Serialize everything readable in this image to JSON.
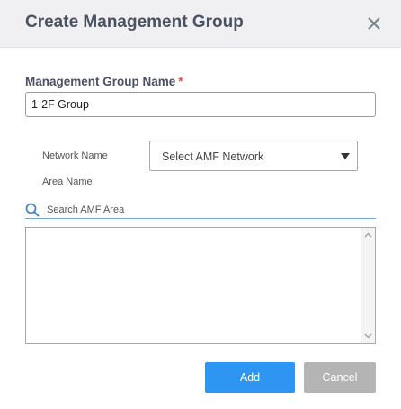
{
  "dialog": {
    "title": "Create Management Group"
  },
  "form": {
    "group_name_label": "Management Group Name",
    "required_marker": "*",
    "group_name_value": "1-2F Group",
    "network_name_label": "Network Name",
    "network_select_value": "Select AMF Network",
    "area_name_label": "Area Name",
    "search_placeholder": "Search AMF Area"
  },
  "buttons": {
    "add_label": "Add",
    "cancel_label": "Cancel"
  },
  "icons": {
    "close": "close-icon",
    "search": "search-icon",
    "dropdown": "caret-down-icon",
    "scroll_up": "chevron-up-icon",
    "scroll_down": "chevron-down-icon"
  },
  "colors": {
    "header_bg": "#f0f0f2",
    "title_text": "#4a5160",
    "required": "#d9534f",
    "primary_button": "#2e95f3",
    "secondary_button": "#b4b4b4",
    "search_icon": "#4a86c5"
  }
}
